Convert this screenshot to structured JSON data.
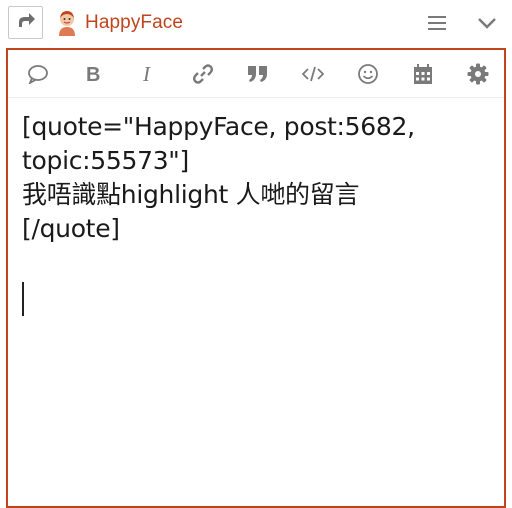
{
  "header": {
    "username": "HappyFace",
    "icons": [
      "reply-icon",
      "avatar",
      "hamburger-menu-icon",
      "chevron-down-icon"
    ]
  },
  "toolbar": {
    "buttons": [
      {
        "name": "comment",
        "icon": "speech-bubble-icon"
      },
      {
        "name": "bold",
        "icon": "bold-icon",
        "label": "B"
      },
      {
        "name": "italic",
        "icon": "italic-icon",
        "label": "I"
      },
      {
        "name": "link",
        "icon": "link-icon"
      },
      {
        "name": "quote",
        "icon": "quote-icon"
      },
      {
        "name": "code",
        "icon": "code-icon"
      },
      {
        "name": "emoji",
        "icon": "smiley-icon"
      },
      {
        "name": "date",
        "icon": "calendar-icon"
      },
      {
        "name": "options",
        "icon": "gear-icon"
      }
    ]
  },
  "editor": {
    "lines": [
      "[quote=\"HappyFace, post:5682,",
      "topic:55573\"]",
      "我唔識點highlight 人哋的留言",
      "[/quote]"
    ]
  },
  "colors": {
    "accent": "#c0451e",
    "icon": "#7a7a7a",
    "text": "#1a1a1a"
  }
}
